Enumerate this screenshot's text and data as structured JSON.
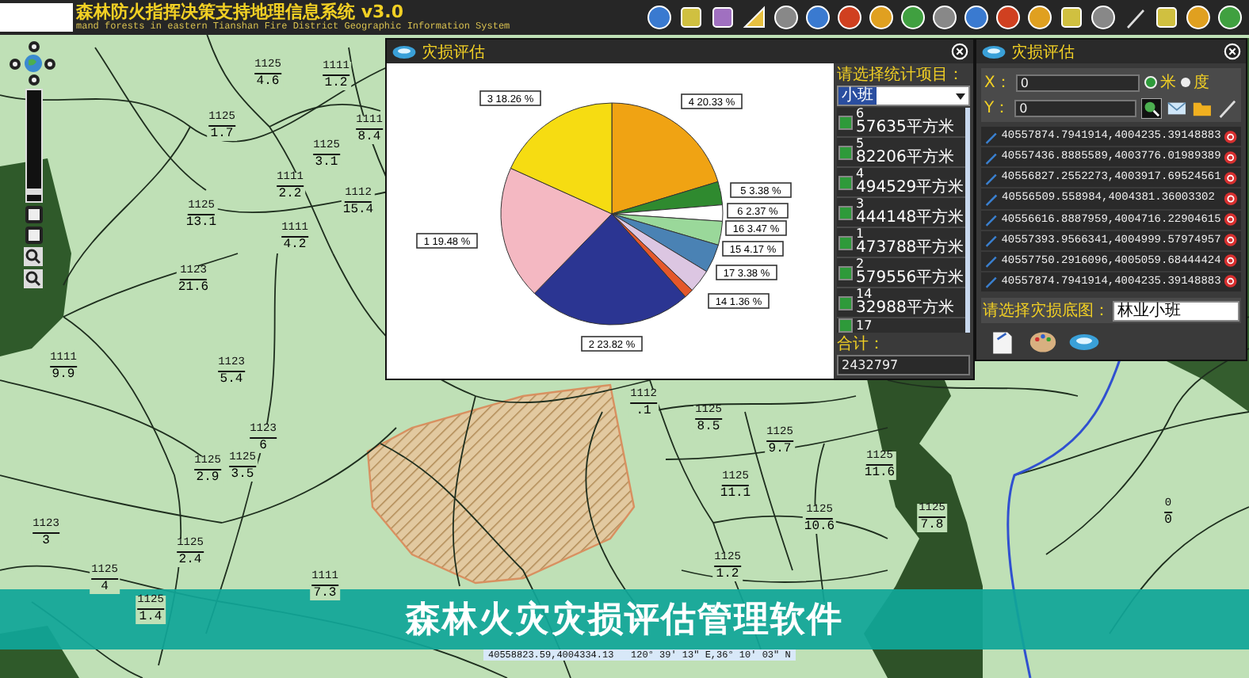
{
  "top_bar": {
    "title": "森林防火指挥决策支持地理信息系统 v3.0",
    "subtitle": "mand forests in eastern Tianshan Fire District Geographic Information System"
  },
  "navigator": {
    "zoom_slider": {
      "level": 0.06
    }
  },
  "map": {
    "parcels": [
      {
        "code": "1125",
        "number": "4.6"
      },
      {
        "code": "1111",
        "number": "1.2"
      },
      {
        "code": "1125",
        "number": "1.7"
      },
      {
        "code": "1111",
        "number": "8.4"
      },
      {
        "code": "1125",
        "number": "3.1"
      },
      {
        "code": "1111",
        "number": "2.2"
      },
      {
        "code": "1112",
        "number": "15.4"
      },
      {
        "code": "1125",
        "number": "13.1"
      },
      {
        "code": "1111",
        "number": "4.2"
      },
      {
        "code": "1123",
        "number": "21.6"
      },
      {
        "code": "1111",
        "number": "9.9"
      },
      {
        "code": "1123",
        "number": "5.4"
      },
      {
        "code": "1123",
        "number": "6"
      },
      {
        "code": "1125",
        "number": "2.9"
      },
      {
        "code": "1125",
        "number": "3.5"
      },
      {
        "code": "1123",
        "number": "3"
      },
      {
        "code": "1125",
        "number": "2.4"
      },
      {
        "code": "1125",
        "number": "4"
      },
      {
        "code": "1111",
        "number": "7.3"
      },
      {
        "code": "1125",
        "number": "1.4"
      },
      {
        "code": "1112",
        "number": ".1"
      },
      {
        "code": "1125",
        "number": "8.5"
      },
      {
        "code": "1125",
        "number": "9.7"
      },
      {
        "code": "1125",
        "number": "11.6"
      },
      {
        "code": "1125",
        "number": "11.1"
      },
      {
        "code": "1125",
        "number": "10.6"
      },
      {
        "code": "1125",
        "number": "7.8"
      },
      {
        "code": "1125",
        "number": "1.2"
      },
      {
        "code": "0",
        "number": "0"
      }
    ]
  },
  "chart_window": {
    "title": "灾损评估",
    "stat_label": "请选择统计项目：",
    "stat_select": "小班",
    "items": [
      {
        "name": "6",
        "area": "57635平方米",
        "checked": true
      },
      {
        "name": "5",
        "area": "82206平方米",
        "checked": true
      },
      {
        "name": "4",
        "area": "494529平方米",
        "checked": true
      },
      {
        "name": "3",
        "area": "444148平方米",
        "checked": true
      },
      {
        "name": "1",
        "area": "473788平方米",
        "checked": true
      },
      {
        "name": "2",
        "area": "579556平方米",
        "checked": true
      },
      {
        "name": "14",
        "area": "32988平方米",
        "checked": true
      },
      {
        "name": "17",
        "checked": true
      }
    ],
    "total_label": "合计：",
    "total": "2432797",
    "chart_data": {
      "type": "pie",
      "data_labels": true,
      "categories": [
        "4",
        "5",
        "6",
        "16",
        "15",
        "17",
        "14",
        "2",
        "1",
        "3"
      ],
      "values": [
        20.33,
        3.38,
        2.37,
        3.47,
        4.17,
        3.38,
        1.36,
        23.82,
        19.48,
        18.26
      ],
      "colors": [
        "#f0a313",
        "#2f8a2f",
        "#ffffff",
        "#9ad89a",
        "#4a82b4",
        "#dcc6e2",
        "#e4572a",
        "#2b3592",
        "#f4b8c2",
        "#f6dc12"
      ],
      "value_labels": [
        "20.33 %",
        "3.38 %",
        "2.37 %",
        "3.47 %",
        "4.17 %",
        "3.38 %",
        "1.36 %",
        "23.82 %",
        "19.48 %",
        "18.26 %"
      ]
    }
  },
  "assessment_window": {
    "title": "灾损评估",
    "x_label": "X：",
    "x_value": "0",
    "y_label": "Y：",
    "y_value": "0",
    "units": [
      {
        "label": "米",
        "selected": true
      },
      {
        "label": "度",
        "selected": false
      }
    ],
    "points": [
      "40557874.7941914,4004235.39148883",
      "40557436.8885589,4003776.01989389",
      "40556827.2552273,4003917.69524561",
      "40556509.558984,4004381.36003302",
      "40556616.8887959,4004716.22904615",
      "40557393.9566341,4004999.57974957",
      "40557750.2916096,4005059.68444424",
      "40557874.7941914,4004235.39148883"
    ],
    "basemap_label": "请选择灾损底图：",
    "basemap_select": "林业小班"
  },
  "banner": "森林火灾灾损评估管理软件",
  "status": "40558823.59,4004334.13   120° 39' 13\" E,36° 10' 03\" N"
}
